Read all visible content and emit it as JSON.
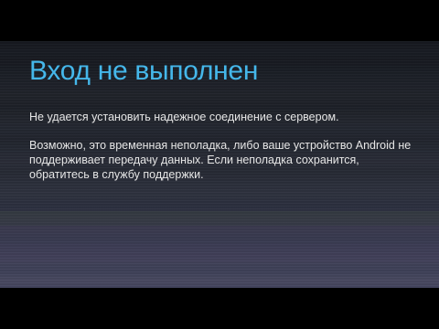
{
  "dialog": {
    "title": "Вход не выполнен",
    "message_line1": "Не удается установить надежное соединение с сервером.",
    "message_line2": "Возможно, это временная неполадка, либо ваше устройство Android не поддерживает передачу данных. Если неполадка сохранится, обратитесь в службу поддержки."
  },
  "colors": {
    "title": "#45b7ea",
    "text": "#e6e6e6",
    "letterbox": "#000000",
    "background_top": "#16191f",
    "background_bottom": "#45465f"
  }
}
